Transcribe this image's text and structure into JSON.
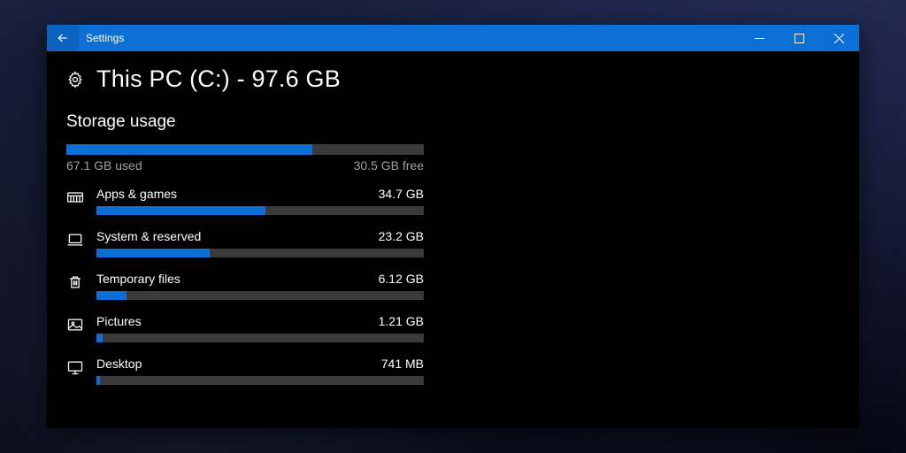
{
  "window": {
    "title": "Settings"
  },
  "page": {
    "title": "This PC (C:) - 97.6 GB",
    "section": "Storage usage",
    "used_label": "67.1 GB used",
    "free_label": "30.5 GB free",
    "used_pct": 68.7
  },
  "categories": [
    {
      "icon": "apps",
      "name": "Apps & games",
      "size": "34.7 GB",
      "pct": 51.7
    },
    {
      "icon": "laptop",
      "name": "System & reserved",
      "size": "23.2 GB",
      "pct": 34.6
    },
    {
      "icon": "trash",
      "name": "Temporary files",
      "size": "6.12 GB",
      "pct": 9.1
    },
    {
      "icon": "picture",
      "name": "Pictures",
      "size": "1.21 GB",
      "pct": 1.8
    },
    {
      "icon": "desktop",
      "name": "Desktop",
      "size": "741 MB",
      "pct": 1.1
    }
  ]
}
